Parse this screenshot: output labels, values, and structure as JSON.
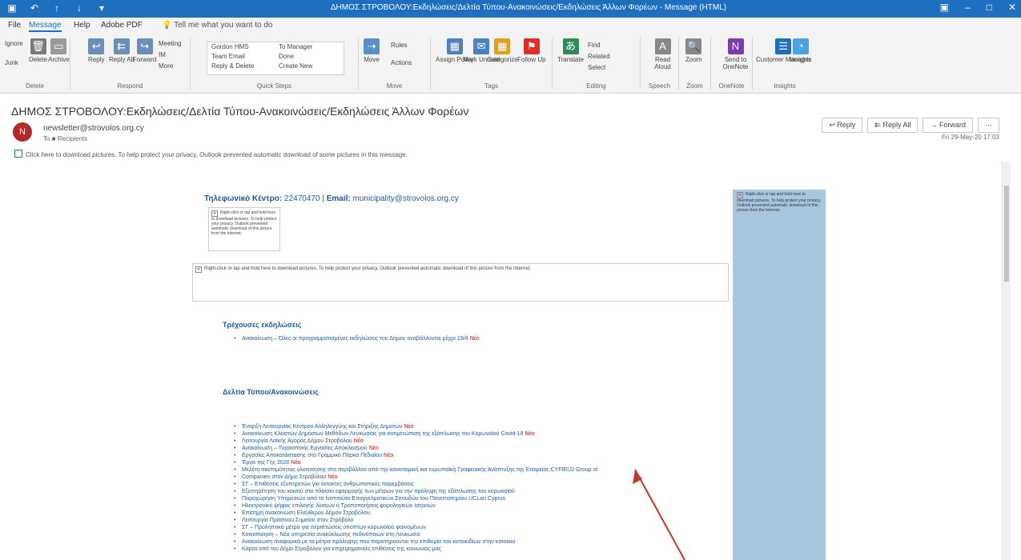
{
  "window": {
    "title": "ΔΗΜΟΣ ΣΤΡΟΒΟΛΟΥ:Εκδηλώσεις/Δελτία Τύπου-Ανακοινώσεις/Εκδηλώσεις Άλλων Φορέων - Message (HTML)"
  },
  "tabs": [
    "File",
    "Message",
    "Help",
    "Adobe PDF"
  ],
  "tell_me": "Tell me what you want to do",
  "ribbon": {
    "groups": [
      "Delete",
      "Respond",
      "Quick Steps",
      "Move",
      "Tags",
      "Editing",
      "Speech",
      "Zoom",
      "OneNote",
      "Insights"
    ],
    "delete": [
      "Ignore",
      "Junk",
      "Delete",
      "Archive"
    ],
    "respond": [
      "Reply",
      "Reply All",
      "Forward",
      "Meeting",
      "IM",
      "More"
    ],
    "quick_steps": [
      "Gordon HMS",
      "Team Email",
      "Reply & Delete",
      "To Manager",
      "Done",
      "Create New"
    ],
    "move": [
      "Move",
      "Rules",
      "Actions"
    ],
    "tags": [
      "Assign Policy",
      "Mark Unread",
      "Categorize",
      "Follow Up"
    ],
    "editing": [
      "Translate",
      "Find",
      "Related",
      "Select"
    ],
    "speech": [
      "Read Aloud"
    ],
    "zoom": [
      "Zoom"
    ],
    "onenote": [
      "Send to OneNote"
    ],
    "insights": [
      "Customer Manager",
      "Insights"
    ]
  },
  "message": {
    "subject": "ΔΗΜΟΣ ΣΤΡΟΒΟΛΟΥ:Εκδηλώσεις/Δελτία Τύπου-Ανακοινώσεις/Εκδηλώσεις Άλλων Φορέων",
    "avatar_initial": "N",
    "sender": "newsletter@strovolos.org.cy",
    "recipient": "To ■ Recipients",
    "info_bar": "Click here to download pictures. To help protect your privacy, Outlook prevented automatic download of some pictures in this message.",
    "date": "Fri 29-May-20 17:03",
    "actions": [
      "Reply",
      "Reply All",
      "Forward",
      "⋯"
    ]
  },
  "body": {
    "contact_label": "Τηλεφωνικό Κέντρο:",
    "contact_phone": "22470470",
    "contact_email_label": "Email:",
    "contact_email": "municipality@strovolos.org.cy",
    "blocked_image_text_short": "Right-click or tap and hold here to download pictures. To help protect your privacy, Outlook prevented automatic download of this picture from the Internet.",
    "blocked_image_text_long": "Right-click or tap and hold here to download pictures. To help protect your privacy, Outlook prevented automatic download of this picture from the Internet.",
    "section1_title": "Τρέχουσες εκδηλώσεις",
    "section1_items": [
      {
        "text": "Ανακοίνωση – Όλες οι προγραμματισμένες εκδηλώσεις του Δήμου αναβάλλονται μέχρι 19/4",
        "new": "Νέο"
      }
    ],
    "section2_title": "Δελτία Τύπου/Ανακοινώσεις",
    "section2_items": [
      {
        "text": "Έναρξη Λειτουργίας Κέντρου Αλληλεγγύης και Στήριξης Δημοτών",
        "new": "Νέο"
      },
      {
        "text": "Ανακοίνωση Κλειστών Δημόσιων Μεθόδων Λευκωσίας για αντιμετώπιση της εξάπλωσης του Κορωνοϊού Covid-19",
        "new": "Νέο"
      },
      {
        "text": "Λειτουργία Λαϊκής Αγοράς Δήμου Στροβόλου",
        "new": "Νέο"
      },
      {
        "text": "Ανακοίνωση – Τυχαιοποιής Εργασίες Αποκλεισμού",
        "new": "Νέο"
      },
      {
        "text": "Εργασίες Αποκατάστασης στο Γραμμικό Πάρκο Πεδιαίου",
        "new": "Νέο"
      },
      {
        "text": "Έργα της Γης 2020",
        "new": "Νέο"
      },
      {
        "text": "Μελέτη σκοπιμότητας υλοποίησης στο περιβάλλον από την καινοτομική και ευρωπαϊκή Γραφειακής Ανάπτυξης της Εταιρείας CYFIELD Group of",
        "new": ""
      },
      {
        "text": "Companies στον Δήμο Στροβόλου",
        "new": "Νέο"
      },
      {
        "text": "ΣΓ – Επιθέσεις εξυπηρετών για έκτακτες ανθρωπιστικές παρεμβάσεις",
        "new": ""
      },
      {
        "text": "Εξυπηρέτηση του κοινού στο πλαίσιο εφαρμογής των μέτρων για την πρόληψη της εξάπλωσης του κορωνοϊού",
        "new": ""
      },
      {
        "text": "Παραχώρηση Υπηρεσιών από το Ινστιτούτο Επαγγελματικών Σπουδών του Πανεπιστημίου UCLan Cyprus",
        "new": ""
      },
      {
        "text": "Ηλεκτρονική ψήφος επιλογής λύσεων ή Τροποποιήσεις φορολογικών Ιατρείων",
        "new": ""
      },
      {
        "text": "Επίσημη ανακοίνωση Ελεύθερου Δήμου Στροβόλου",
        "new": ""
      },
      {
        "text": "Λειτουργία Πράσινου Σημείου στον Στρόβολο",
        "new": ""
      },
      {
        "text": "ΣΓ – Προληπτικά μέτρα για περιπτώσεις ύποπτων κορωνοϊού φαινομένων",
        "new": ""
      },
      {
        "text": "Κοινοποίηση – Νέα υπηρεσία ανακύκλωσης πεδινόποιων στη Λευκωσία",
        "new": ""
      },
      {
        "text": "Ανακοίνωση αναφορικά με τα μέτρα πρόληψης που παρατηρούνται την επιθυμία του κατοικιδίων στην κατοικία",
        "new": ""
      },
      {
        "text": "Κάρτα από τον Δήμο Στροβόλου για επιχειρηματικές επιθέσεις της κοινωνίας μας",
        "new": ""
      }
    ]
  }
}
